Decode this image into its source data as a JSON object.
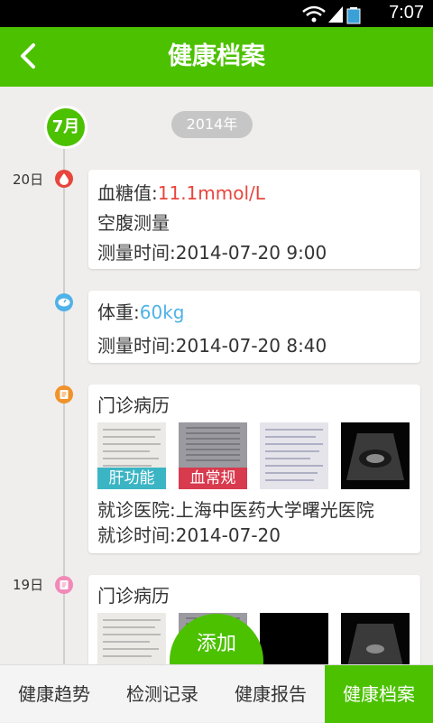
{
  "status_bar": {
    "time": "7:07",
    "icons": [
      "wifi-icon",
      "signal-icon",
      "battery-icon"
    ]
  },
  "header": {
    "title": "健康档案",
    "back_icon": "chevron-left-icon"
  },
  "timeline": {
    "month": "7月",
    "year": "2014年",
    "days": [
      "20日",
      "19日"
    ]
  },
  "records": [
    {
      "type": "blood-glucose",
      "label": "血糖值:",
      "value": "11.1mmol/L",
      "note": "空腹测量",
      "time_label": "测量时间:",
      "time": "2014-07-20 9:00"
    },
    {
      "type": "weight",
      "label": "体重:",
      "value": "60kg",
      "time_label": "测量时间:",
      "time": "2014-07-20 8:40"
    },
    {
      "type": "medical-record",
      "title": "门诊病历",
      "thumb_tags": [
        "肝功能",
        "血常规"
      ],
      "hospital_label": "就诊医院:",
      "hospital": "上海中医药大学曙光医院",
      "date_label": "就诊时间:",
      "date": "2014-07-20"
    },
    {
      "type": "medical-record",
      "title": "门诊病历"
    }
  ],
  "fab": {
    "label": "添加"
  },
  "bottom_nav": [
    {
      "label": "健康趋势"
    },
    {
      "label": "检测记录"
    },
    {
      "label": "健康报告"
    },
    {
      "label": "健康档案",
      "active": true
    }
  ],
  "colors": {
    "brand_green": "#4cc100",
    "glucose_red": "#e8453c",
    "weight_blue": "#4fb2e8",
    "record_orange": "#f0922a",
    "record_pink": "#f08ab8",
    "tag_teal": "#3bb5c4",
    "tag_red": "#d83a4e"
  }
}
